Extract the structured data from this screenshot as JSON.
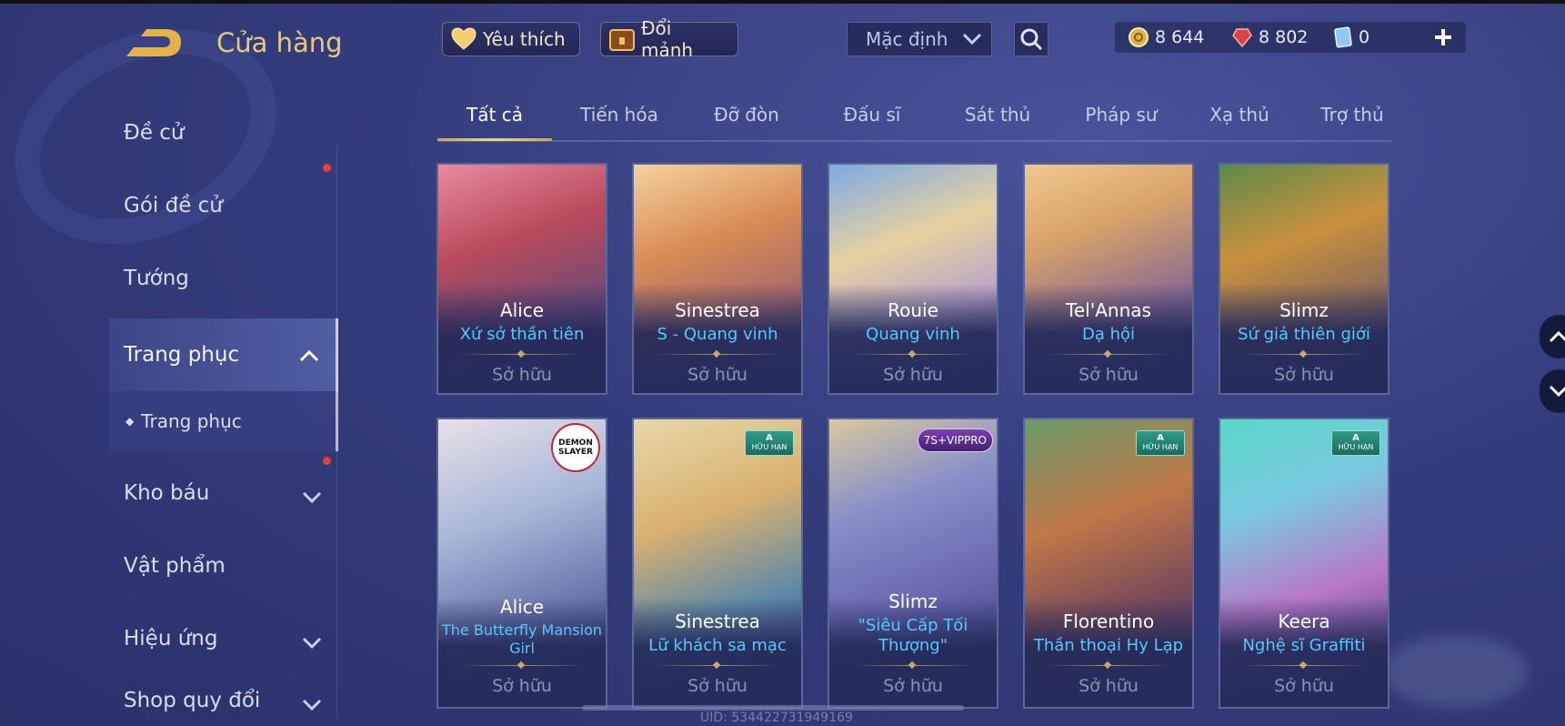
{
  "header": {
    "title": "Cửa hàng",
    "favorites_label": "Yêu thích",
    "exchange_label": "Đổi mảnh",
    "sort_value": "Mặc định",
    "currencies": [
      {
        "icon": "gold-coin-icon",
        "value": "8 644"
      },
      {
        "icon": "red-gem-icon",
        "value": "8 802"
      },
      {
        "icon": "voucher-icon",
        "value": "0"
      }
    ]
  },
  "sidebar": {
    "items": [
      {
        "label": "Đề cử"
      },
      {
        "label": "Gói đề cử"
      },
      {
        "label": "Tướng"
      },
      {
        "label": "Trang phục"
      },
      {
        "label": "Trang phục"
      },
      {
        "label": "Kho báu"
      },
      {
        "label": "Vật phẩm"
      },
      {
        "label": "Hiệu ứng"
      },
      {
        "label": "Shop quy đổi"
      }
    ]
  },
  "tabs": [
    "Tất cả",
    "Tiến hóa",
    "Đỡ đòn",
    "Đấu sĩ",
    "Sát thủ",
    "Pháp sư",
    "Xạ thủ",
    "Trợ thủ"
  ],
  "cards": [
    {
      "hero": "Alice",
      "skin": "Xứ sở thần tiên",
      "status": "Sở hữu"
    },
    {
      "hero": "Sinestrea",
      "skin": "S - Quang vinh",
      "status": "Sở hữu"
    },
    {
      "hero": "Rouie",
      "skin": "Quang vinh",
      "status": "Sở hữu"
    },
    {
      "hero": "Tel'Annas",
      "skin": "Dạ hội",
      "status": "Sở hữu"
    },
    {
      "hero": "Slimz",
      "skin": "Sứ giả thiên giới",
      "status": "Sở hữu"
    },
    {
      "hero": "Alice",
      "skin_line1": "The Butterfly Mansion",
      "skin_line2": "Girl",
      "status": "Sở hữu",
      "badge": "DEMON SLAYER"
    },
    {
      "hero": "Sinestrea",
      "skin": "Lữ khách sa mạc",
      "status": "Sở hữu",
      "badge_grade": "A",
      "badge_text": "HỮU HẠN"
    },
    {
      "hero": "Slimz",
      "skin_line1": "\"Siêu Cấp Tối",
      "skin_line2": "Thượng\"",
      "status": "Sở hữu",
      "badge": "7S+VIPPRO"
    },
    {
      "hero": "Florentino",
      "skin": "Thần thoại Hy Lạp",
      "status": "Sở hữu",
      "badge_grade": "A",
      "badge_text": "HỮU HẠN"
    },
    {
      "hero": "Keera",
      "skin": "Nghệ sĩ Graffiti",
      "status": "Sở hữu",
      "badge_grade": "A",
      "badge_text": "HỮU HẠN"
    }
  ],
  "footer": {
    "uid": "UID: 534422731949169"
  },
  "colors": {
    "accent_gold": "#e8c97a",
    "skin_blue": "#55c8ff",
    "notify_red": "#ee3a3a"
  }
}
